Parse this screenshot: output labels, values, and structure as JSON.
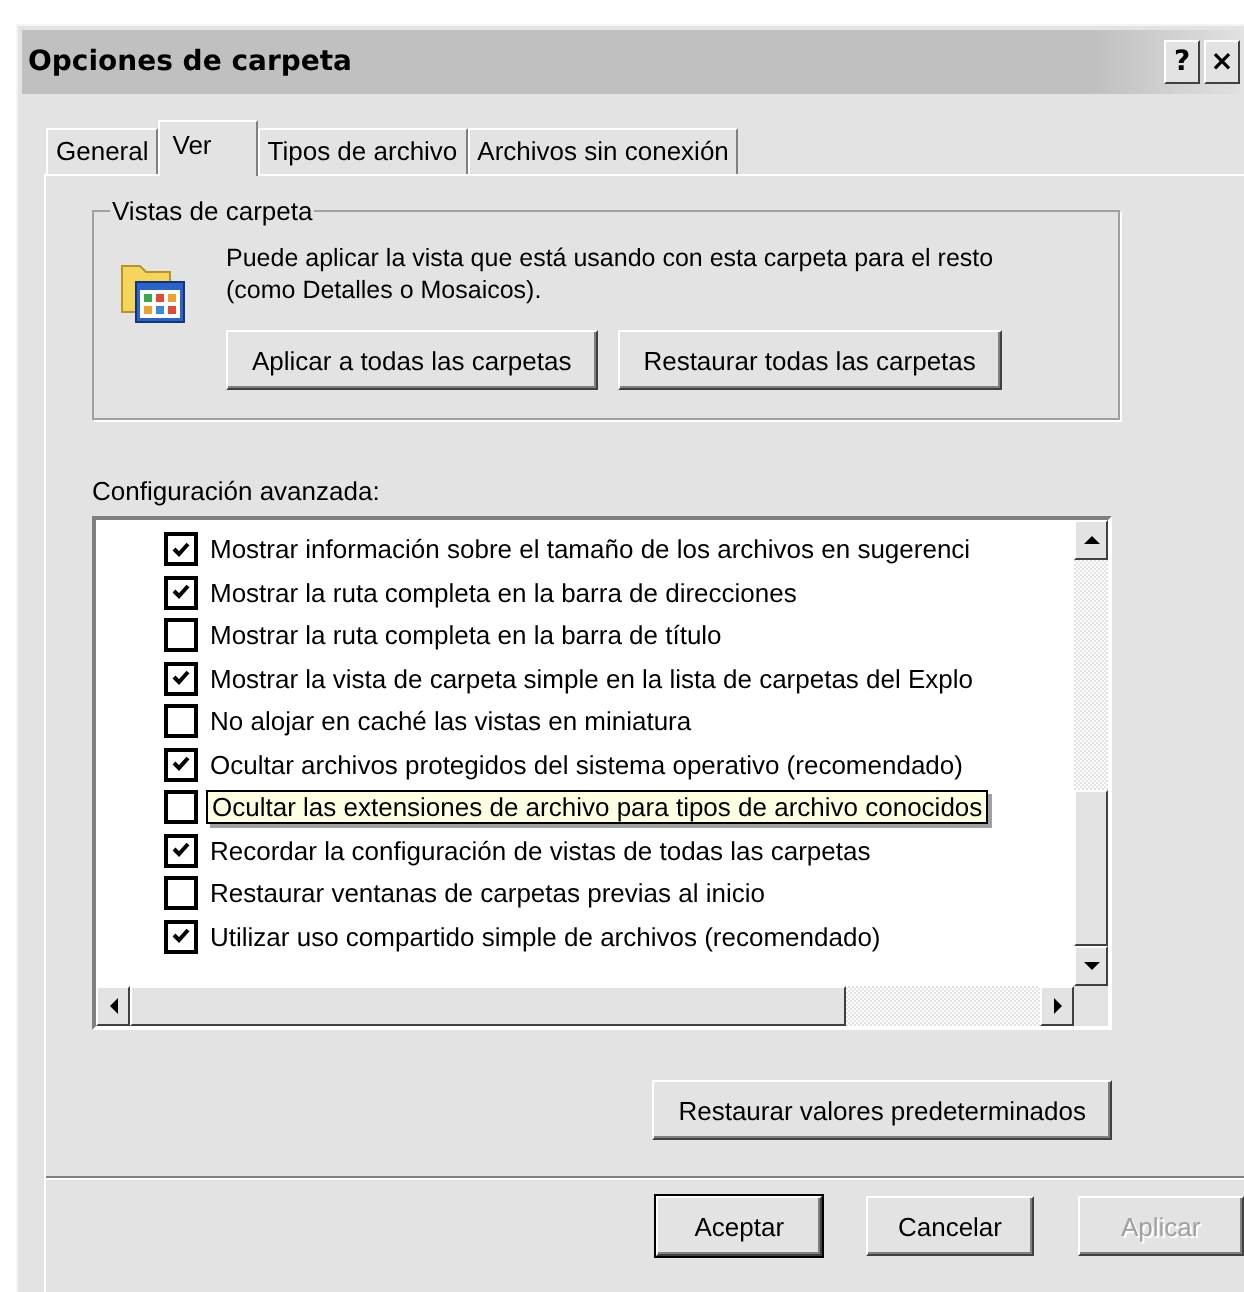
{
  "window": {
    "title": "Opciones de carpeta",
    "title_buttons": [
      "?",
      "×"
    ]
  },
  "tabs": [
    {
      "label": "General",
      "selected": false
    },
    {
      "label": "Ver",
      "selected": true
    },
    {
      "label": "Tipos de archivo",
      "selected": false
    },
    {
      "label": "Archivos sin conexión",
      "selected": false
    }
  ],
  "folder_views": {
    "legend": "Vistas de carpeta",
    "description": "Puede aplicar la vista que está usando con esta carpeta para el resto (como Detalles o Mosaicos).",
    "buttons": [
      "Aplicar a todas las carpetas",
      "Restaurar todas las carpetas"
    ]
  },
  "advanced": {
    "label": "Configuración avanzada:",
    "items": [
      {
        "label": "Mostrar información sobre el tamaño de los archivos en sugerenci",
        "checked": true,
        "tooltip": false
      },
      {
        "label": "Mostrar la ruta completa en la barra de direcciones",
        "checked": true,
        "tooltip": false
      },
      {
        "label": "Mostrar la ruta completa en la barra de título",
        "checked": false,
        "tooltip": false
      },
      {
        "label": "Mostrar la vista de carpeta simple en la lista de carpetas del Explo",
        "checked": true,
        "tooltip": false
      },
      {
        "label": "No alojar en caché las vistas en miniatura",
        "checked": false,
        "tooltip": false
      },
      {
        "label": "Ocultar archivos protegidos del sistema operativo (recomendado)",
        "checked": true,
        "tooltip": false
      },
      {
        "label": "Ocultar las extensiones de archivo para tipos de archivo conocidos",
        "checked": false,
        "tooltip": true
      },
      {
        "label": "Recordar la configuración de vistas de todas las carpetas",
        "checked": true,
        "tooltip": false
      },
      {
        "label": "Restaurar ventanas de carpetas previas al inicio",
        "checked": false,
        "tooltip": false
      },
      {
        "label": "Utilizar uso compartido simple de archivos (recomendado)",
        "checked": true,
        "tooltip": false
      }
    ],
    "restore_button": "Restaurar valores predeterminados"
  },
  "buttons": [
    {
      "label": "Aceptar",
      "disabled": false,
      "default": true
    },
    {
      "label": "Cancelar",
      "disabled": false,
      "default": false
    },
    {
      "label": "Aplicar",
      "disabled": true,
      "default": false
    }
  ]
}
